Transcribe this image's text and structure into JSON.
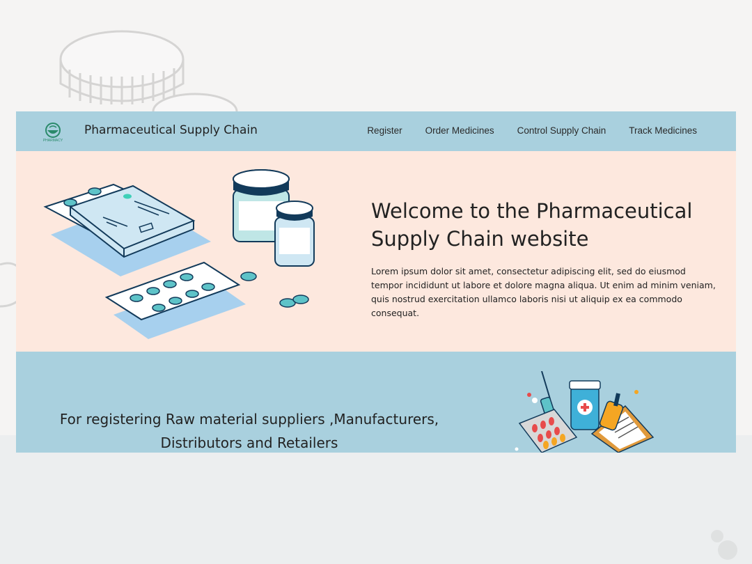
{
  "navbar": {
    "logo_alt": "PHARMACY",
    "brand": "Pharmaceutical Supply Chain",
    "links": [
      "Register",
      "Order Medicines",
      "Control Supply Chain",
      "Track Medicines"
    ]
  },
  "hero": {
    "title": "Welcome to the Pharmaceutical Supply Chain website",
    "text": "Lorem ipsum dolor sit amet, consectetur adipiscing elit, sed do eiusmod tempor incididunt ut labore et dolore magna aliqua. Ut enim ad minim veniam, quis nostrud exercitation ullamco laboris nisi ut aliquip ex ea commodo consequat."
  },
  "register": {
    "text": "For registering Raw material suppliers ,Manufacturers, Distributors and Retailers"
  },
  "colors": {
    "navbar": "#a9d0de",
    "hero": "#fde8de",
    "accent_teal": "#5ec3c8",
    "dark_navy": "#123a5a"
  }
}
